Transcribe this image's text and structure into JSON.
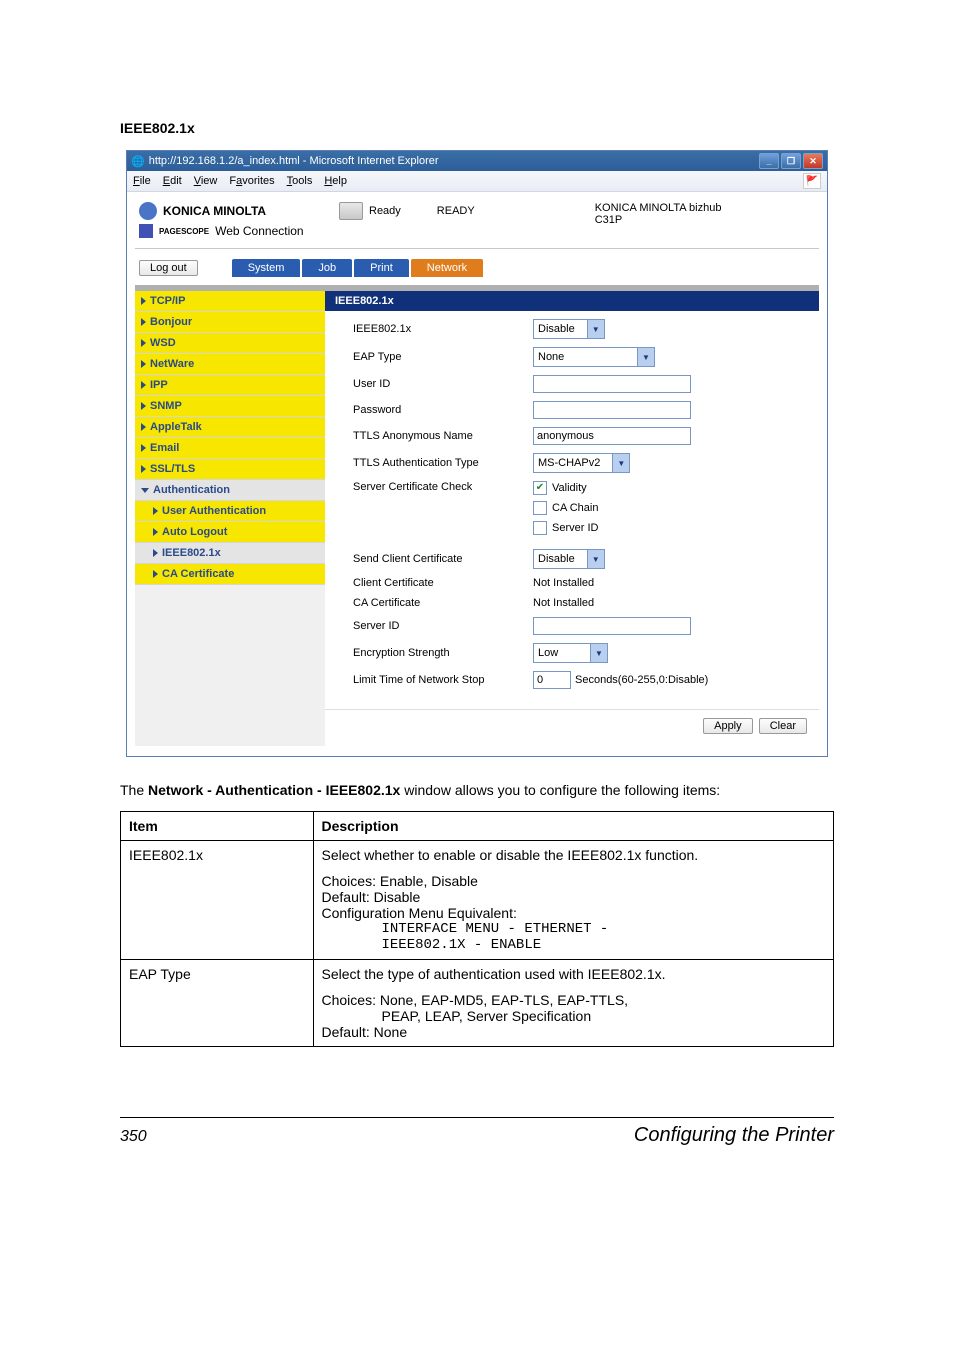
{
  "section_title": "IEEE802.1x",
  "browser": {
    "title": "http://192.168.1.2/a_index.html - Microsoft Internet Explorer",
    "menus": {
      "file": "File",
      "edit": "Edit",
      "view": "View",
      "favorites": "Favorites",
      "tools": "Tools",
      "help": "Help"
    }
  },
  "header": {
    "brand": "KONICA MINOLTA",
    "pagescope_prefix": "PAGESCOPE",
    "pagescope": "Web Connection",
    "ready_label": "Ready",
    "ready_status": "READY",
    "device_line1": "KONICA MINOLTA bizhub",
    "device_line2": "C31P",
    "logout": "Log out"
  },
  "tabs": {
    "system": "System",
    "job": "Job",
    "print": "Print",
    "network": "Network"
  },
  "nav": {
    "tcpip": "TCP/IP",
    "bonjour": "Bonjour",
    "wsd": "WSD",
    "netware": "NetWare",
    "ipp": "IPP",
    "snmp": "SNMP",
    "appletalk": "AppleTalk",
    "email": "Email",
    "ssltls": "SSL/TLS",
    "authentication": "Authentication",
    "user_auth": "User Authentication",
    "auto_logout": "Auto Logout",
    "ieee": "IEEE802.1x",
    "ca_cert": "CA Certificate"
  },
  "pane_title": "IEEE802.1x",
  "form": {
    "ieee_label": "IEEE802.1x",
    "ieee_value": "Disable",
    "eap_label": "EAP Type",
    "eap_value": "None",
    "userid_label": "User ID",
    "userid_value": "",
    "password_label": "Password",
    "password_value": "",
    "ttls_anon_label": "TTLS Anonymous Name",
    "ttls_anon_value": "anonymous",
    "ttls_auth_label": "TTLS Authentication Type",
    "ttls_auth_value": "MS-CHAPv2",
    "server_cert_check_label": "Server Certificate Check",
    "chk_validity": "Validity",
    "chk_cachain": "CA Chain",
    "chk_serverid": "Server ID",
    "send_client_cert_label": "Send Client Certificate",
    "send_client_cert_value": "Disable",
    "client_cert_label": "Client Certificate",
    "client_cert_value": "Not Installed",
    "ca_cert_label": "CA Certificate",
    "ca_cert_value": "Not Installed",
    "server_id_label": "Server ID",
    "server_id_value": "",
    "enc_label": "Encryption Strength",
    "enc_value": "Low",
    "limit_label": "Limit Time of Network Stop",
    "limit_value": "0",
    "limit_suffix": "Seconds(60-255,0:Disable)",
    "apply": "Apply",
    "clear": "Clear"
  },
  "paragraph": {
    "prefix": "The ",
    "bold": "Network - Authentication - IEEE802.1x",
    "suffix": " window allows you to configure the following items:"
  },
  "table": {
    "h_item": "Item",
    "h_desc": "Description",
    "row1_item": "IEEE802.1x",
    "row1_p1": "Select whether to enable or disable the IEEE802.1x function.",
    "row1_p2": "Choices: Enable, Disable",
    "row1_p3": "Default:  Disable",
    "row1_p4": "Configuration Menu Equivalent:",
    "row1_m1": "INTERFACE MENU - ETHERNET -",
    "row1_m2": "IEEE802.1X - ENABLE",
    "row2_item": "EAP Type",
    "row2_p1": "Select the type of authentication used with IEEE802.1x.",
    "row2_p2a": "Choices: None, EAP-MD5, EAP-TLS, EAP-TTLS,",
    "row2_p2b": "PEAP, LEAP, Server Specification",
    "row2_p3": "Default:  None"
  },
  "footer": {
    "page": "350",
    "title": "Configuring the Printer"
  }
}
